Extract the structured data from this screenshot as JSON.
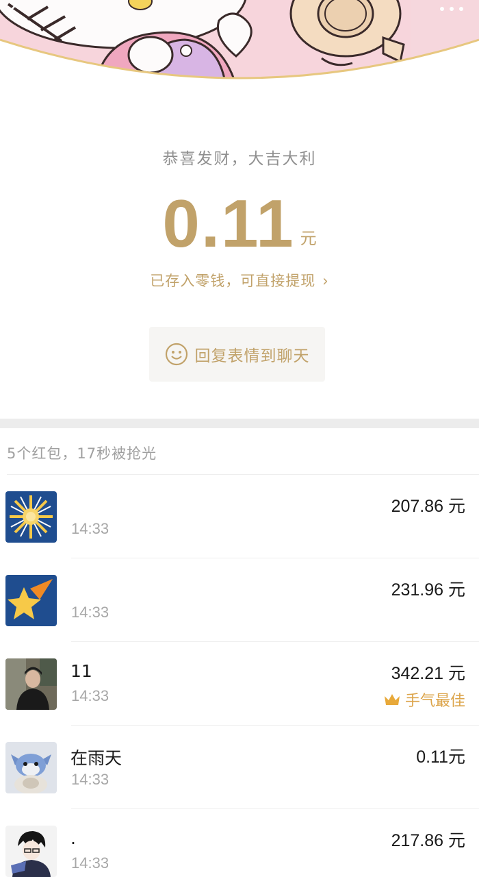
{
  "header": {
    "back_icon": "chevron-left-icon",
    "more_icon": "more-dots-icon"
  },
  "summary": {
    "greeting": "恭喜发财，大吉大利",
    "amount": "0.11",
    "unit": "元",
    "stored_text": "已存入零钱，可直接提现",
    "stored_chevron": "›",
    "reply_button_label": "回复表情到聊天",
    "reply_icon": "smile-face-icon"
  },
  "list": {
    "summary_text": "5个红包，17秒被抢光",
    "best_label": "手气最佳",
    "items": [
      {
        "name": "",
        "time": "14:33",
        "amount": "207.86 元",
        "best": false,
        "avatar": "sun-avatar"
      },
      {
        "name": "",
        "time": "14:33",
        "amount": "231.96 元",
        "best": false,
        "avatar": "star-avatar"
      },
      {
        "name": "11",
        "time": "14:33",
        "amount": "342.21 元",
        "best": true,
        "avatar": "person-photo-avatar"
      },
      {
        "name": "在雨天",
        "time": "14:33",
        "amount": "0.11元",
        "best": false,
        "avatar": "plush-toy-avatar"
      },
      {
        "name": ".",
        "time": "14:33",
        "amount": "217.86 元",
        "best": false,
        "avatar": "anime-boy-avatar"
      }
    ]
  },
  "colors": {
    "gold": "#c1a26a",
    "best_orange": "#dca44a",
    "gray_text": "#a7a7a7",
    "divider": "#ececec"
  }
}
